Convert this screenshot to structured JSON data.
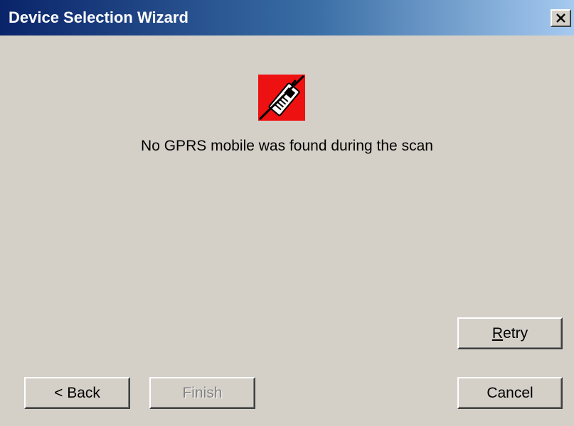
{
  "window": {
    "title": "Device Selection Wizard",
    "close_icon": "close-x-icon"
  },
  "status": {
    "icon": "no-mobile-device-icon",
    "icon_colors": {
      "background": "#ee1111",
      "strike": "#000000",
      "device": "#ffffff"
    },
    "message": "No GPRS mobile was found during the scan"
  },
  "buttons": {
    "retry": {
      "first_letter": "R",
      "rest": "etry"
    },
    "back": "< Back",
    "finish": "Finish",
    "cancel": "Cancel"
  },
  "colors": {
    "titlebar_start": "#0a246a",
    "titlebar_end": "#a6caf0",
    "dialog_bg": "#d4d0c8"
  }
}
